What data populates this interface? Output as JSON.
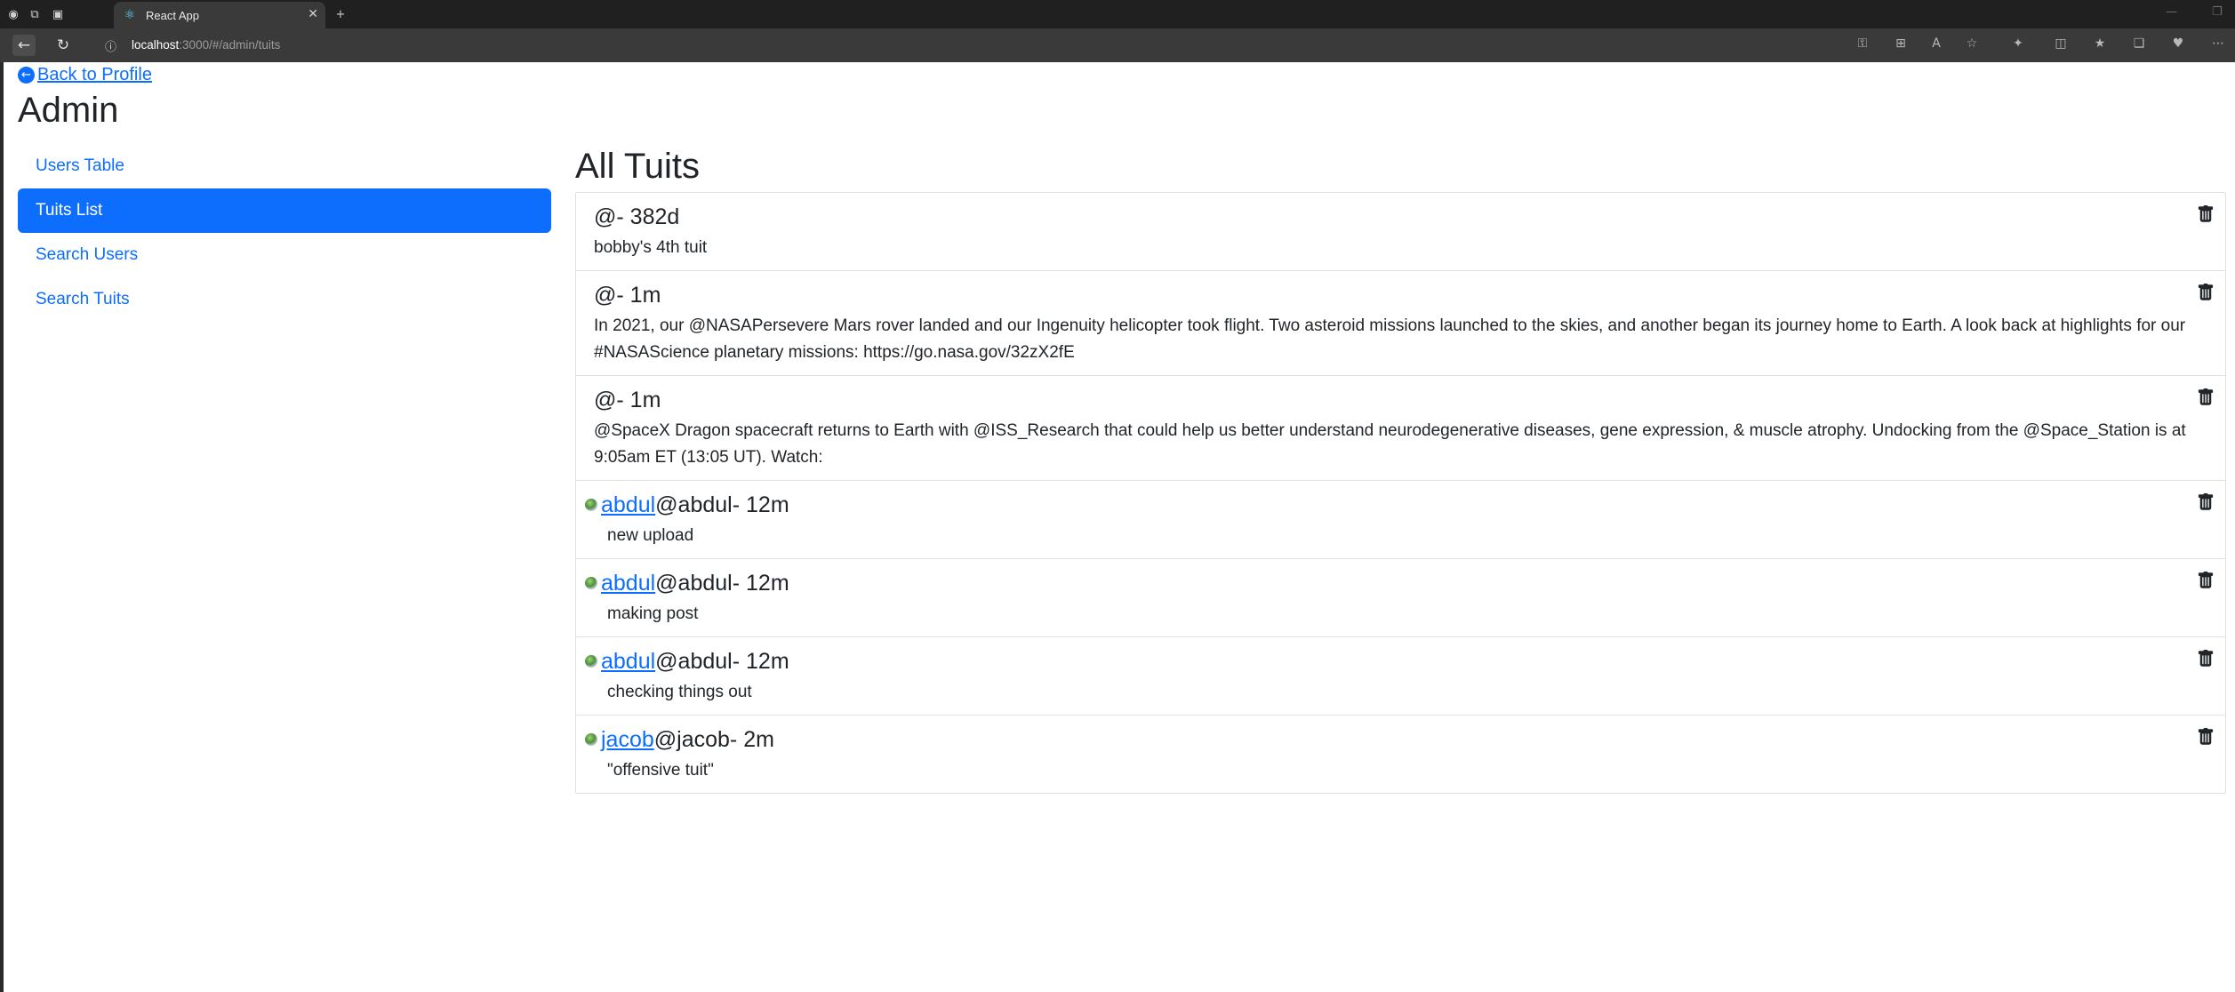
{
  "browser": {
    "tab_title": "React App",
    "url_host": "localhost",
    "url_path": ":3000/#/admin/tuits"
  },
  "page": {
    "back_link": "Back to Profile",
    "admin_title": "Admin",
    "sidebar": {
      "items": [
        {
          "label": "Users Table",
          "active": false
        },
        {
          "label": "Tuits List",
          "active": true
        },
        {
          "label": "Search Users",
          "active": false
        },
        {
          "label": "Search Tuits",
          "active": false
        }
      ]
    },
    "main_title": "All Tuits",
    "tuits": [
      {
        "username": "",
        "handle": "@",
        "time": " - 382d",
        "text": "bobby's 4th tuit",
        "avatar": false
      },
      {
        "username": "",
        "handle": "@",
        "time": " - 1m",
        "text": "In 2021, our @NASAPersevere Mars rover landed and our Ingenuity helicopter took flight. Two asteroid missions launched to the skies, and another began its journey home to Earth. A look back at highlights for our #NASAScience planetary missions: https://go.nasa.gov/32zX2fE",
        "avatar": false
      },
      {
        "username": "",
        "handle": "@",
        "time": " - 1m",
        "text": "@SpaceX Dragon spacecraft returns to Earth with @ISS_Research that could help us better understand neurodegenerative diseases, gene expression, & muscle atrophy. Undocking from the @Space_Station is at 9:05am ET (13:05 UT). Watch:",
        "avatar": false
      },
      {
        "username": "abdul",
        "handle": "@abdul",
        "time": " - 12m",
        "text": "new upload",
        "avatar": true
      },
      {
        "username": "abdul",
        "handle": "@abdul",
        "time": " - 12m",
        "text": "making post",
        "avatar": true
      },
      {
        "username": "abdul",
        "handle": "@abdul",
        "time": " - 12m",
        "text": "checking things out",
        "avatar": true
      },
      {
        "username": "jacob",
        "handle": "@jacob",
        "time": " - 2m",
        "text": "\"offensive tuit\"",
        "avatar": true
      }
    ]
  },
  "colors": {
    "accent": "#0d6efd",
    "text": "#212529",
    "border": "#dee2e6",
    "chrome_dark": "#202020",
    "chrome_bar": "#3a3a3a"
  }
}
